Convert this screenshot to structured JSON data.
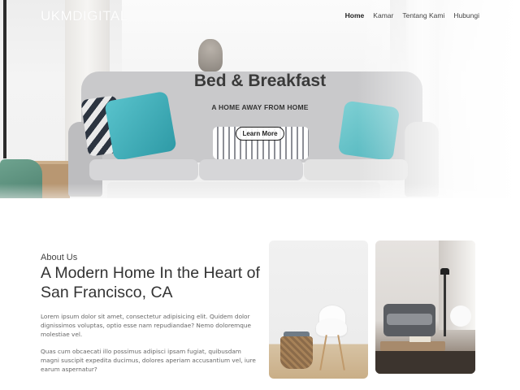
{
  "brand": {
    "logo_bold": "UKM",
    "logo_thin": "DIGITAL"
  },
  "nav": {
    "items": [
      {
        "label": "Home",
        "active": true
      },
      {
        "label": "Kamar",
        "active": false
      },
      {
        "label": "Tentang Kami",
        "active": false
      },
      {
        "label": "Hubungi",
        "active": false
      }
    ]
  },
  "hero": {
    "title": "Bed & Breakfast",
    "subtitle": "A HOME AWAY FROM HOME",
    "cta_label": "Learn More"
  },
  "about": {
    "eyebrow": "About Us",
    "heading": "A Modern Home In the Heart of San Francisco, CA",
    "paragraph_1": "Lorem ipsum dolor sit amet, consectetur adipisicing elit. Quidem dolor dignissimos voluptas, optio esse nam repudiandae? Nemo doloremque molestiae vel.",
    "paragraph_2": "Quas cum obcaecati illo possimus adipisci ipsam fugiat, quibusdam magni suscipit expedita ducimus, dolores aperiam accusantium vel, iure earum aspernatur?"
  },
  "colors": {
    "accent_teal": "#3fb1bb",
    "text_dark": "#333333",
    "text_muted": "#666666"
  }
}
